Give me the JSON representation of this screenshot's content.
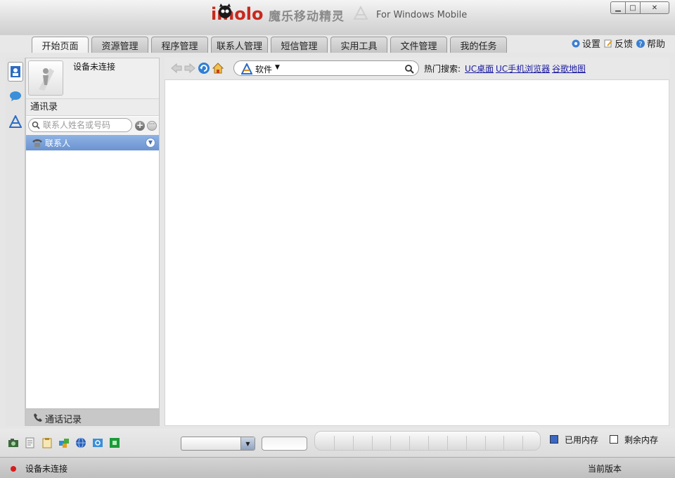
{
  "title": {
    "logo": "imolo",
    "name_cn": "魔乐移动精灵",
    "subtitle": "For Windows Mobile"
  },
  "window_controls": {
    "minimize": "▁",
    "maximize": "□",
    "close": "✕"
  },
  "tabs": [
    {
      "label": "开始页面",
      "active": true
    },
    {
      "label": "资源管理",
      "active": false
    },
    {
      "label": "程序管理",
      "active": false
    },
    {
      "label": "联系人管理",
      "active": false
    },
    {
      "label": "短信管理",
      "active": false
    },
    {
      "label": "实用工具",
      "active": false
    },
    {
      "label": "文件管理",
      "active": false
    },
    {
      "label": "我的任务",
      "active": false
    }
  ],
  "top_links": {
    "settings": "设置",
    "feedback": "反馈",
    "help": "帮助"
  },
  "left_panel": {
    "device_status": "设备未连接",
    "section_title": "通讯录",
    "search_placeholder": "联系人姓名或号码",
    "add_icon": "+",
    "more_icon": "···",
    "group": "联系人",
    "call_log": "通话记录"
  },
  "browser": {
    "address_label": "软件",
    "address_caret": "▼",
    "hot_search_label": "热门搜索:",
    "hot_links": [
      "UC桌面",
      "UC手机浏览器",
      "谷歌地图"
    ]
  },
  "bottom": {
    "combo_arrow": "▼",
    "memory_used_fraction": 0,
    "legend_used": "已用内存",
    "legend_free": "剩余内存"
  },
  "status": {
    "connection": "设备未连接",
    "version_label": "当前版本"
  },
  "colors": {
    "accent": "#c8281e",
    "used_memory": "#3b68c6",
    "link": "#1a1aa0",
    "status_dot": "#d81c1c",
    "selected_row": "#7ea3dc"
  }
}
